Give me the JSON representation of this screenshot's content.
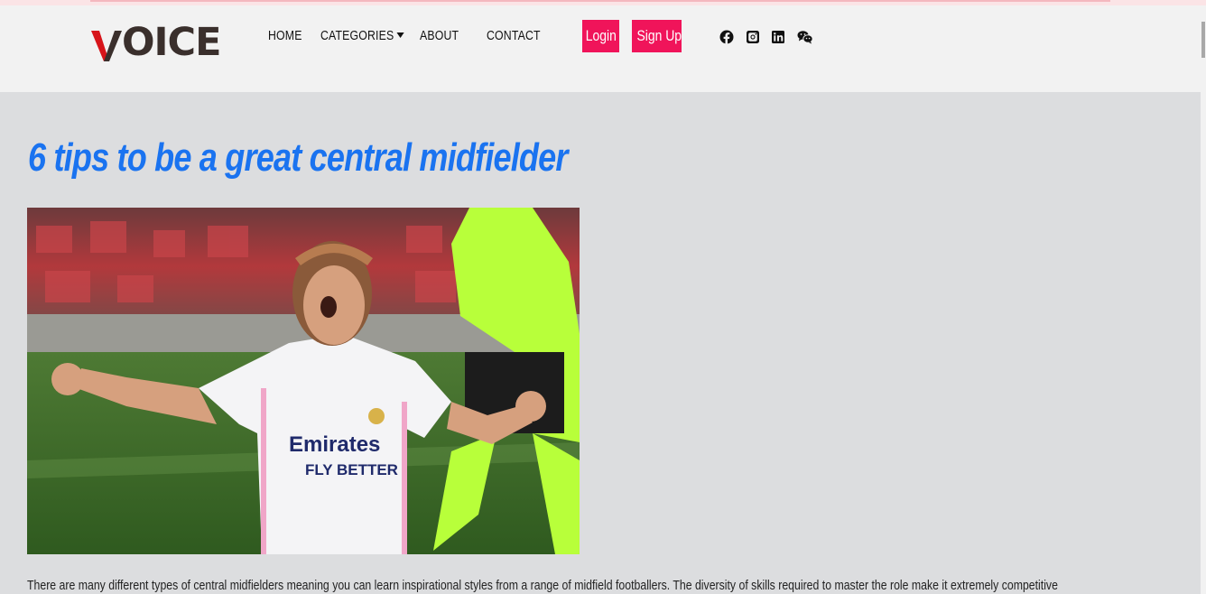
{
  "brand": {
    "logo_text": "OICE",
    "logo_accent_color": "#d7141a"
  },
  "nav": {
    "home": "HOME",
    "categories": "CATEGORIES",
    "about": "ABOUT",
    "contact": "CONTACT"
  },
  "auth": {
    "login": "Login",
    "signup": "Sign Up",
    "button_color": "#f0145a"
  },
  "social": [
    "facebook-icon",
    "instagram-icon",
    "linkedin-icon",
    "wechat-icon"
  ],
  "article": {
    "title": "6 tips to be a great central midfielder",
    "title_color": "#1a73f0",
    "hero_jersey_sponsor": "Emirates",
    "hero_jersey_tagline": "FLY BETTER",
    "body_first_line": "There are many different types of central midfielders meaning you can learn inspirational styles from a range of midfield footballers. The diversity of skills required to master the role make it extremely competitive"
  }
}
